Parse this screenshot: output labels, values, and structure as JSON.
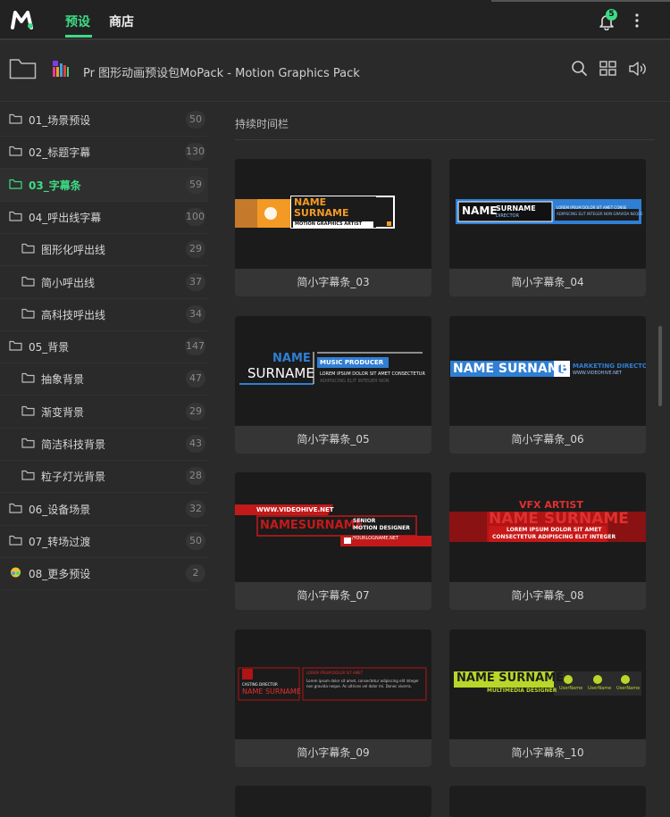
{
  "topbar": {
    "tabs": [
      {
        "label": "预设",
        "active": true
      },
      {
        "label": "商店",
        "active": false
      }
    ],
    "notification_count": "5"
  },
  "path": {
    "title": "Pr 图形动画预设包MoPack - Motion Graphics Pack"
  },
  "sidebar": {
    "items": [
      {
        "label": "01_场景预设",
        "count": "50",
        "level": 0,
        "active": false
      },
      {
        "label": "02_标题字幕",
        "count": "130",
        "level": 0,
        "active": false
      },
      {
        "label": "03_字幕条",
        "count": "59",
        "level": 0,
        "active": true
      },
      {
        "label": "04_呼出线字幕",
        "count": "100",
        "level": 0,
        "active": false
      },
      {
        "label": "图形化呼出线",
        "count": "29",
        "level": 1,
        "active": false
      },
      {
        "label": "简小呼出线",
        "count": "37",
        "level": 1,
        "active": false
      },
      {
        "label": "高科技呼出线",
        "count": "34",
        "level": 1,
        "active": false
      },
      {
        "label": "05_背景",
        "count": "147",
        "level": 0,
        "active": false
      },
      {
        "label": "抽象背景",
        "count": "47",
        "level": 1,
        "active": false
      },
      {
        "label": "渐变背景",
        "count": "29",
        "level": 1,
        "active": false
      },
      {
        "label": "简洁科技背景",
        "count": "43",
        "level": 1,
        "active": false
      },
      {
        "label": "粒子灯光背景",
        "count": "28",
        "level": 1,
        "active": false
      },
      {
        "label": "06_设备场景",
        "count": "32",
        "level": 0,
        "active": false
      },
      {
        "label": "07_转场过渡",
        "count": "50",
        "level": 0,
        "active": false
      },
      {
        "label": "08_更多预设",
        "count": "2",
        "level": 0,
        "active": false,
        "special": true
      }
    ]
  },
  "main": {
    "section_title": "持续时间栏",
    "cards": [
      {
        "caption": "简小字幕条_03",
        "thumb": {
          "l1": "NAME",
          "l2": "SURNAME",
          "l3": "MOTION GRAPHICS ARTIST"
        }
      },
      {
        "caption": "简小字幕条_04",
        "thumb": {
          "l1": "NAME",
          "l2": "SURNAME",
          "l3": "DIRECTOR",
          "l4": "LOREM IPSUM DOLOR SIT AMET CONSE",
          "l5": "ADIPISCING ELIT INTEGER NON GRAVIDA NEQUE"
        }
      },
      {
        "caption": "简小字幕条_05",
        "thumb": {
          "l1": "NAME",
          "l2": "SURNAME",
          "l3": "MUSIC PRODUCER",
          "l4": "LOREM IPSUM DOLOR SIT AMET CONSECTETUR",
          "l5": "ADIPISCING ELIT INTEGER NON"
        }
      },
      {
        "caption": "简小字幕条_06",
        "thumb": {
          "l1": "NAME SURNAME",
          "l3": "MARKETING DIRECTOR",
          "l4": "WWW.VIDEOHIVE.NET"
        }
      },
      {
        "caption": "简小字幕条_07",
        "thumb": {
          "l1": "WWW.VIDEOHIVE.NET",
          "l2": "NAMESURNAME",
          "l3": "SENIOR",
          "l4": "MOTION DESIGNER",
          "l5": "/YOURLOGNAME.NET"
        }
      },
      {
        "caption": "简小字幕条_08",
        "thumb": {
          "l1": "VFX ARTIST",
          "l2": "NAME SURNAME",
          "l3": "LOREM IPSUM DOLOR SIT AMET",
          "l4": "CONSECTETUR ADIPISCING ELIT INTEGER"
        }
      },
      {
        "caption": "简小字幕条_09",
        "thumb": {
          "l1": "CASTING DIRECTOR",
          "l2": "NAME SURNAME",
          "l3": "LOREM IPSUM DOLOR SIT AMET",
          "l4": "Lorem ipsum dolor sit amet, consectetur adipiscing elit integer non gravida neque. Ac ultrices vel dolor mi. Donec viverra."
        }
      },
      {
        "caption": "简小字幕条_10",
        "thumb": {
          "l1": "NAME SURNAME",
          "l2": "MULTIMEDIA DESIGNER",
          "l3": "UserName",
          "l4": "UserName",
          "l5": "UserName"
        }
      }
    ]
  },
  "colors": {
    "accent": "#3ddc84",
    "background": "#2a2a2a",
    "topbar": "#222222"
  }
}
